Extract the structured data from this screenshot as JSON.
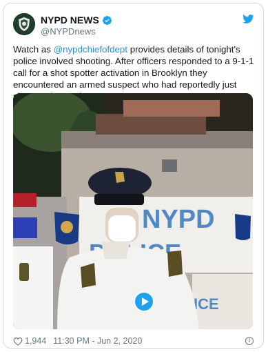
{
  "tweet": {
    "display_name": "NYPD NEWS",
    "handle": "@NYPDnews",
    "text_before_mention": "Watch as ",
    "mention": "@nypdchiefofdept",
    "text_after_mention": " provides details of tonight's police involved shooting. After officers responded to a 9-1-1 call for a shot spotter activation in Brooklyn they encountered an armed suspect who had reportedly just shot another male.",
    "likes": "1,944",
    "timestamp": "11:30 PM - Jun 2, 2020"
  },
  "icons": {
    "avatar": "nypd-shield-logo",
    "verified": "verified-badge-icon",
    "platform": "twitter-bird-icon",
    "like": "heart-icon",
    "info": "info-icon",
    "play": "play-icon"
  },
  "colors": {
    "accent": "#1da1f2",
    "link": "#1b95e0",
    "secondary_text": "#657786",
    "border": "#cfd9de"
  }
}
